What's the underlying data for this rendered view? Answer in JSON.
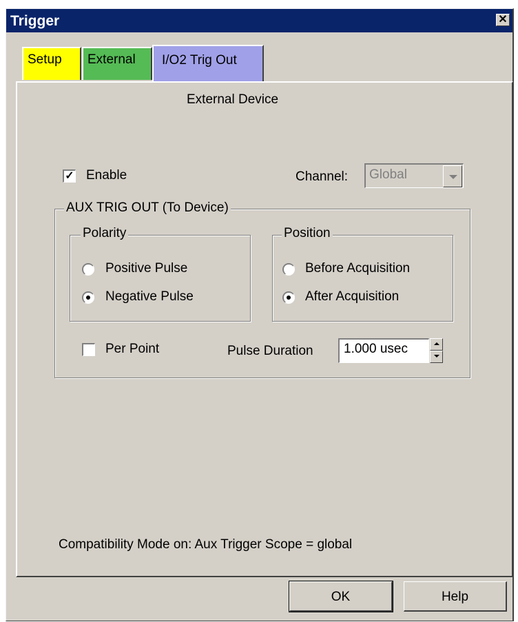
{
  "window": {
    "title": "Trigger"
  },
  "tabs": [
    {
      "label": "Setup",
      "color": "#ffff00"
    },
    {
      "label": "External",
      "color": "#55bb55"
    },
    {
      "label": "I/O2 Trig Out",
      "color": "#a0a0e8",
      "active": true
    }
  ],
  "panel": {
    "heading": "External Device",
    "enable": {
      "label": "Enable",
      "checked": true
    },
    "channel": {
      "label": "Channel:",
      "value": "Global",
      "disabled": true
    },
    "aux_group": {
      "legend": "AUX TRIG OUT (To Device)",
      "polarity": {
        "legend": "Polarity",
        "options": [
          {
            "label": "Positive Pulse",
            "selected": false
          },
          {
            "label": "Negative Pulse",
            "selected": true
          }
        ]
      },
      "position": {
        "legend": "Position",
        "options": [
          {
            "label": "Before Acquisition",
            "selected": false
          },
          {
            "label": "After Acquisition",
            "selected": true
          }
        ]
      },
      "per_point": {
        "label": "Per Point",
        "checked": false
      },
      "pulse_duration": {
        "label": "Pulse Duration",
        "value": "1.000 usec"
      }
    },
    "status_text": "Compatibility Mode on: Aux Trigger Scope = global"
  },
  "buttons": {
    "ok": "OK",
    "help": "Help"
  },
  "icons": {
    "close": "close-icon",
    "check": "checkmark-icon"
  }
}
